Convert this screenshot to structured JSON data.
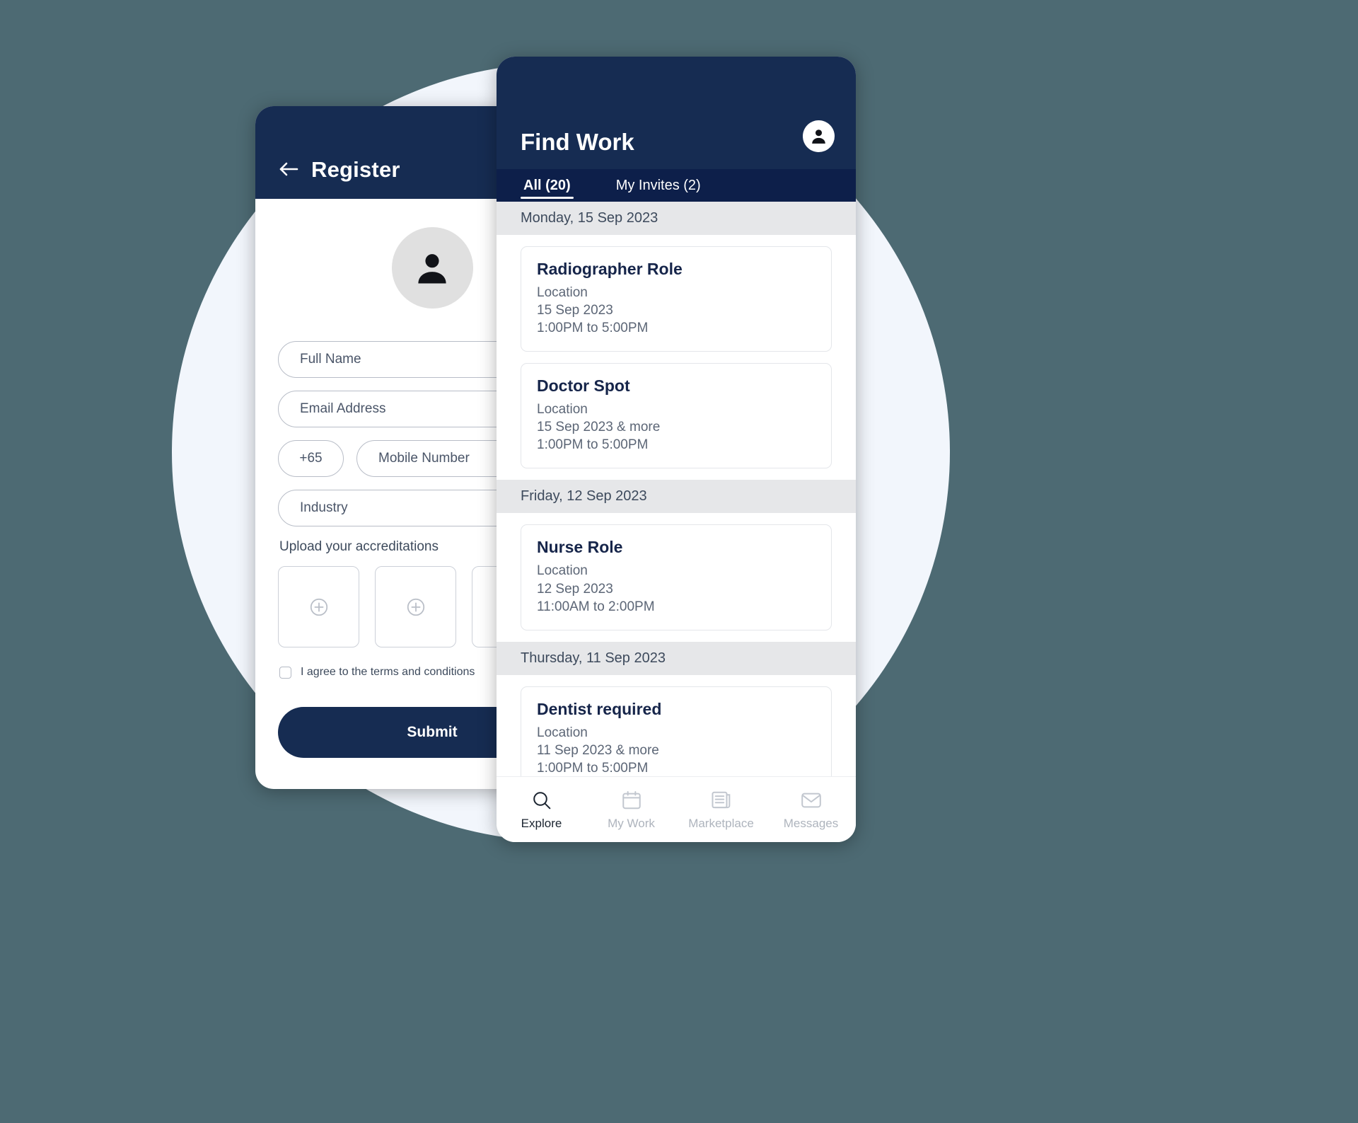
{
  "theme": {
    "background": "#4d6a73",
    "circle": "#f2f6fc",
    "navy": "#162c52",
    "navy_dark": "#0d1f4a",
    "card_border": "#e4e6ea",
    "date_header_bg": "#e6e7e9",
    "muted_text": "#5c6676",
    "title_text": "#16254a"
  },
  "register_screen": {
    "back_icon": "arrow-left-icon",
    "title": "Register",
    "avatar_icon": "person-icon",
    "fields": {
      "full_name": {
        "placeholder": "Full Name",
        "value": ""
      },
      "email": {
        "placeholder": "Email Address",
        "value": ""
      },
      "country_code": {
        "value": "+65"
      },
      "mobile": {
        "placeholder": "Mobile Number",
        "value": ""
      },
      "industry": {
        "placeholder": "Industry",
        "value": ""
      }
    },
    "upload": {
      "label": "Upload your accreditations",
      "slots": [
        {
          "icon": "plus-circle-icon"
        },
        {
          "icon": "plus-circle-icon"
        },
        {
          "icon": "plus-circle-icon"
        }
      ]
    },
    "terms": {
      "checked": false,
      "label": "I agree to the terms and conditions"
    },
    "submit_label": "Submit"
  },
  "findwork_screen": {
    "title": "Find Work",
    "profile_icon": "person-circle-icon",
    "tabs": [
      {
        "label": "All (20)",
        "active": true
      },
      {
        "label": "My Invites (2)",
        "active": false
      }
    ],
    "groups": [
      {
        "date": "Monday, 15 Sep 2023",
        "jobs": [
          {
            "title": "Radiographer Role",
            "location": "Location",
            "date": "15 Sep 2023",
            "time": "1:00PM to 5:00PM"
          },
          {
            "title": "Doctor Spot",
            "location": "Location",
            "date": "15 Sep 2023 & more",
            "time": "1:00PM to 5:00PM"
          }
        ]
      },
      {
        "date": "Friday, 12 Sep 2023",
        "jobs": [
          {
            "title": "Nurse Role",
            "location": "Location",
            "date": "12 Sep 2023",
            "time": "11:00AM to 2:00PM"
          }
        ]
      },
      {
        "date": "Thursday, 11 Sep 2023",
        "jobs": [
          {
            "title": "Dentist required",
            "location": "Location",
            "date": "11 Sep 2023 & more",
            "time": "1:00PM to 5:00PM"
          }
        ]
      }
    ],
    "bottom_nav": [
      {
        "label": "Explore",
        "icon": "search-icon",
        "active": true
      },
      {
        "label": "My Work",
        "icon": "calendar-icon",
        "active": false
      },
      {
        "label": "Marketplace",
        "icon": "newspaper-icon",
        "active": false
      },
      {
        "label": "Messages",
        "icon": "envelope-icon",
        "active": false
      }
    ]
  }
}
